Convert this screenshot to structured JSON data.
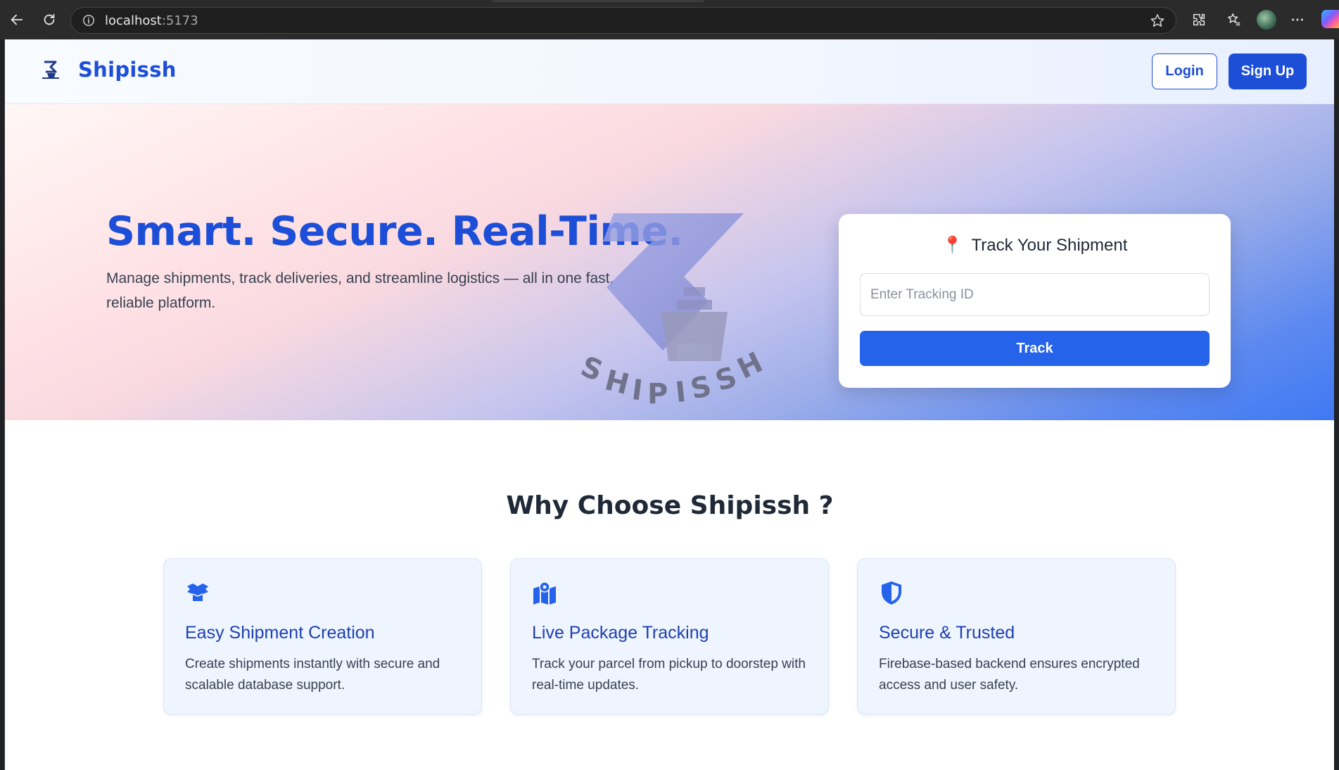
{
  "browser": {
    "url_host": "localhost",
    "url_port": ":5173"
  },
  "nav": {
    "brand": "Shipissh",
    "login_label": "Login",
    "signup_label": "Sign Up"
  },
  "hero": {
    "title": "Smart. Secure. Real-Time.",
    "subtitle": "Manage shipments, track deliveries, and streamline logistics — all in one fast, reliable platform."
  },
  "tracker": {
    "pin_icon": "📍",
    "title": "Track Your Shipment",
    "placeholder": "Enter Tracking ID",
    "value": "",
    "button_label": "Track"
  },
  "features": {
    "heading": "Why Choose Shipissh ?",
    "items": [
      {
        "icon": "box-open-icon",
        "title": "Easy Shipment Creation",
        "description": "Create shipments instantly with secure and scalable database support."
      },
      {
        "icon": "map-pin-icon",
        "title": "Live Package Tracking",
        "description": "Track your parcel from pickup to doorstep with real-time updates."
      },
      {
        "icon": "shield-icon",
        "title": "Secure & Trusted",
        "description": "Firebase-based backend ensures encrypted access and user safety."
      }
    ]
  },
  "colors": {
    "primary": "#1d4ed8",
    "button": "#2563eb",
    "card_bg": "#eff5ff"
  }
}
